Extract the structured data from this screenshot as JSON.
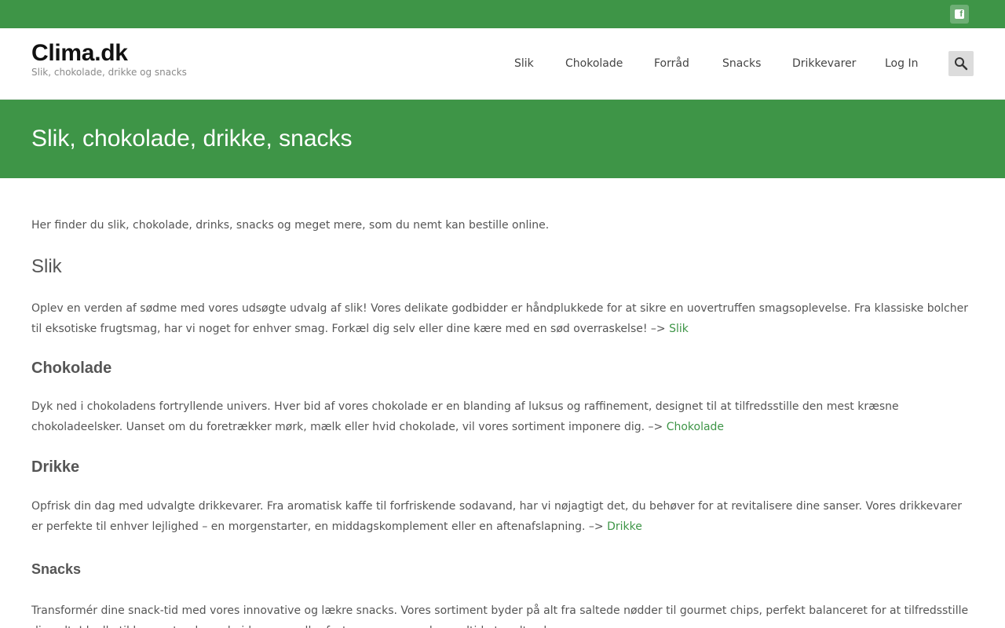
{
  "topbar": {
    "social_icon": "facebook-icon",
    "color": "#3e9547"
  },
  "header": {
    "site_title": "Clima.dk",
    "tagline": "Slik, chokolade, drikke og snacks",
    "nav": [
      "Slik",
      "Chokolade",
      "Forråd",
      "Snacks",
      "Drikkevarer",
      "Log In"
    ],
    "search_icon": "search-icon"
  },
  "hero": {
    "title": "Slik, chokolade, drikke, snacks"
  },
  "content": {
    "intro": "Her finder du slik, chokolade, drinks, snacks og meget mere, som du nemt kan bestille online.",
    "sections": [
      {
        "heading": "Slik",
        "text": "Oplev en verden af sødme med vores udsøgte udvalg af slik! Vores delikate godbidder er håndplukkede for at sikre en uovertruffen smagsoplevelse. Fra klassiske bolcher til eksotiske frugtsmag, har vi noget for enhver smag. Forkæl dig selv eller dine kære med en sød overraskelse! –> ",
        "link": "Slik"
      },
      {
        "heading": "Chokolade",
        "text": "Dyk ned i chokoladens fortryllende univers. Hver bid af vores chokolade er en blanding af luksus og raffinement, designet til at tilfredsstille den mest kræsne chokoladeelsker. Uanset om du foretrækker mørk, mælk eller hvid chokolade, vil vores sortiment imponere dig. –> ",
        "link": "Chokolade"
      },
      {
        "heading": "Drikke",
        "text": "Opfrisk din dag med udvalgte drikkevarer. Fra aromatisk kaffe til forfriskende sodavand, har vi nøjagtigt det, du behøver for at revitalisere dine sanser. Vores drikkevarer er perfekte til enhver lejlighed – en morgenstarter, en middagskomplement eller en aftenafslapning. –> ",
        "link": "Drikke"
      },
      {
        "heading": "Snacks",
        "text": "Transformér dine snack-tid med vores innovative og lækre snacks. Vores sortiment byder på alt fra saltede nødder til gourmet chips, perfekt balanceret for at tilfredsstille din sult. Ideelle til hyggestunder, arbejdspauser eller fester – vores snacks er altid et godt valg."
      }
    ]
  },
  "colors": {
    "accent": "#3e9547",
    "link": "#3e9547",
    "text": "#555555"
  }
}
